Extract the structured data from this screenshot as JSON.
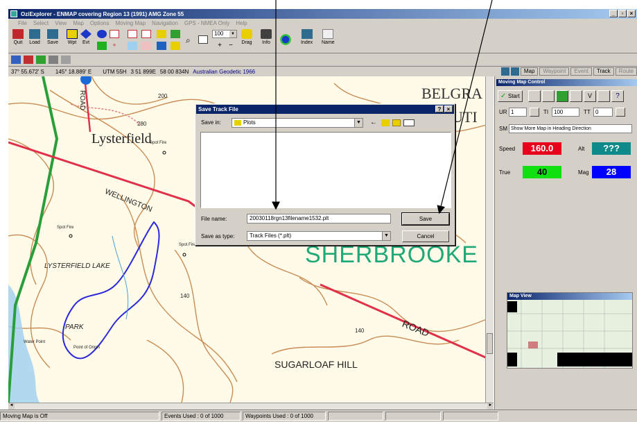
{
  "window": {
    "title": "OziExplorer - ENMAP covering Region 13 (1991) AMG Zone 55",
    "controls": [
      "_",
      "▫",
      "×"
    ]
  },
  "menu": [
    "File",
    "Select",
    "View",
    "Map",
    "Options",
    "Moving Map",
    "Navigation",
    "GPS - NMEA Only",
    "Help"
  ],
  "toolbar": {
    "quit": "Quit",
    "load": "Load",
    "save": "Save",
    "wpt": "Wpt",
    "evt": "Evt",
    "zoom_value": "100",
    "drag": "Drag",
    "info": "Info",
    "index": "Index",
    "name": "Name"
  },
  "coords": {
    "lat": "37° 55.672' S",
    "lon": "145° 18.889' E",
    "utm": "UTM 55H",
    "easting": "3 51 899E",
    "northing": "58 00 834N",
    "datum": "Australian Geodetic 1966"
  },
  "right_tabs": [
    "Map",
    "Waypoint",
    "Event",
    "Track",
    "Route"
  ],
  "map_labels": {
    "belgrave": "BELGRA",
    "south": "UTI",
    "lysterfield": "Lysterfield",
    "wellington": "WELLINGTON",
    "road1": "ROAD",
    "lake": "LYSTERFIELD LAKE",
    "park": "PARK",
    "sherbrooke": "SHERBROOKE",
    "road2": "ROAD",
    "sugarloaf": "SUGARLOAF HILL",
    "spot_fire_1": "Spot Fire",
    "spot_fire_2": "Spot Fire",
    "spot_fire_3": "Spot Fire",
    "water_point": "Water Point",
    "point_origin": "Point of Origin",
    "c200": "200",
    "c280": "280",
    "c140a": "140",
    "c140b": "140"
  },
  "panel": {
    "title": "Moving Map Control",
    "start": "Start",
    "ur_label": "UR",
    "ur_value": "1",
    "ti_label": "TI",
    "ti_value": "100",
    "tt_label": "TT",
    "tt_value": "0",
    "sm_label": "SM",
    "sm_value": "Show More Map in Heading Direction",
    "speed_label": "Speed",
    "speed_value": "160.0",
    "alt_label": "Alt",
    "alt_value": "???",
    "true_label": "True",
    "true_value": "40",
    "mag_label": "Mag",
    "mag_value": "28"
  },
  "map_view": {
    "title": "Map View"
  },
  "dialog": {
    "title": "Save Track File",
    "help": "?",
    "close": "×",
    "save_in_label": "Save in:",
    "save_in_value": "Plots",
    "filename_label": "File name:",
    "filename_value": "20030118rgn13filename1532.plt",
    "type_label": "Save as type:",
    "type_value": "Track Files (*.plt)",
    "save_btn": "Save",
    "cancel_btn": "Cancel"
  },
  "status": {
    "moving": "Moving Map is Off",
    "events": "Events Used : 0 of 1000",
    "waypoints": "Waypoints Used : 0 of 1000"
  },
  "colors": {
    "speed_bg": "#e8001c",
    "alt_bg": "#0f8a8a",
    "true_bg": "#10e010",
    "mag_bg": "#0000ff",
    "contour": "#c0783a",
    "road": "#e0304a",
    "track": "#2a28d8"
  }
}
